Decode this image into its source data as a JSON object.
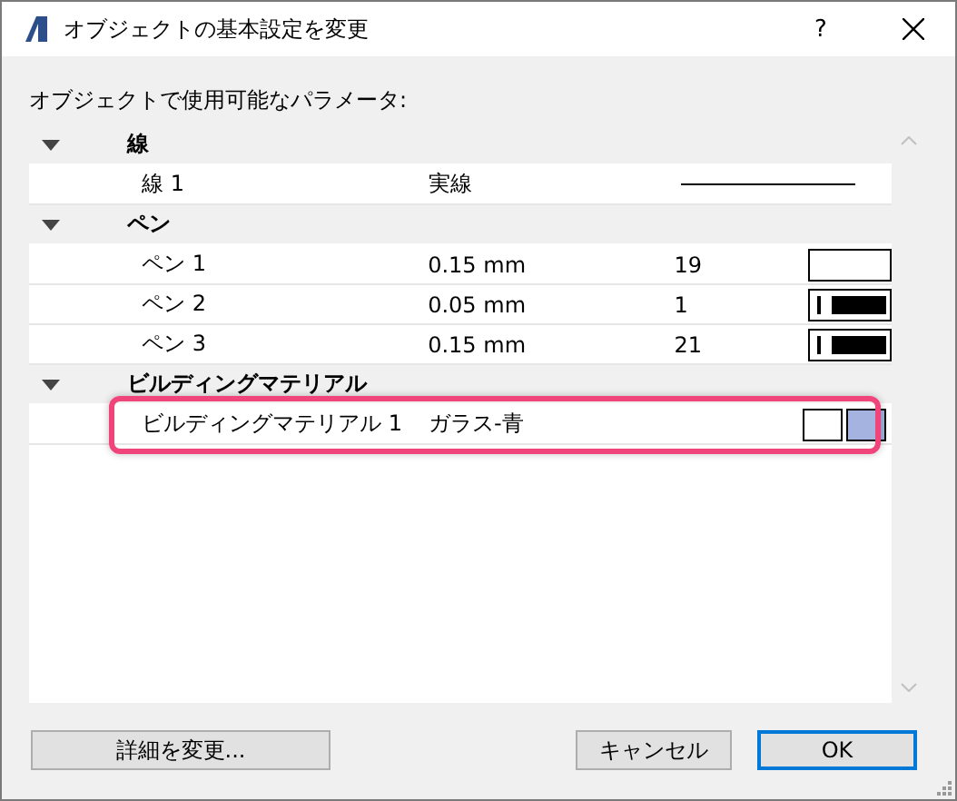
{
  "window": {
    "title": "オブジェクトの基本設定を変更",
    "help": "?"
  },
  "list_label": "オブジェクトで使用可能なパラメータ:",
  "groups": [
    {
      "name": "線",
      "expanded": true,
      "items": [
        {
          "kind": "line",
          "name": "線 1",
          "value": "実線",
          "highlighted": false
        }
      ]
    },
    {
      "name": "ペン",
      "expanded": true,
      "items": [
        {
          "kind": "pen",
          "name": "ペン 1",
          "value": "0.15 mm",
          "number": "19",
          "color": "#ffffff",
          "highlighted": false
        },
        {
          "kind": "pen",
          "name": "ペン 2",
          "value": "0.05 mm",
          "number": "1",
          "color": "#000000",
          "highlighted": false
        },
        {
          "kind": "pen",
          "name": "ペン 3",
          "value": "0.15 mm",
          "number": "21",
          "color": "#000000",
          "highlighted": false
        }
      ]
    },
    {
      "name": "ビルディングマテリアル",
      "expanded": true,
      "items": [
        {
          "kind": "material",
          "name": "ビルディングマテリアル 1",
          "value": "ガラス-青",
          "color": "#a5b3e0",
          "highlighted": true
        }
      ]
    }
  ],
  "buttons": [
    {
      "label": "詳細を変更...",
      "default": false
    },
    {
      "label": "キャンセル",
      "default": false
    },
    {
      "label": "OK",
      "default": true
    }
  ]
}
